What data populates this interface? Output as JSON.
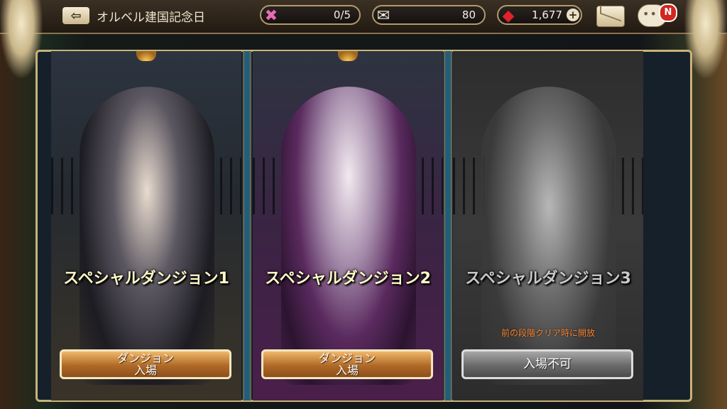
{
  "header": {
    "back_label": "オルベル建国記念日",
    "counters": [
      {
        "icon": "crossed-swords-icon",
        "value": "0/5"
      },
      {
        "icon": "ticket-icon",
        "value": "80"
      },
      {
        "icon": "red-gem-icon",
        "value": "1,677"
      }
    ],
    "notification_badge": "N"
  },
  "dungeons": [
    {
      "title": "スペシャルダンジョン1",
      "button_line1": "ダンジョン",
      "button_line2": "入場",
      "note": "",
      "locked": false
    },
    {
      "title": "スペシャルダンジョン2",
      "button_line1": "ダンジョン",
      "button_line2": "入場",
      "note": "",
      "locked": false
    },
    {
      "title": "スペシャルダンジョン3",
      "button_line1": "入場不可",
      "button_line2": "",
      "note": "前の段階クリア時に開放",
      "locked": true
    }
  ],
  "colors": {
    "accent_gold": "#c9b27a",
    "enter_button": "#b06a28",
    "locked_button": "#6a6a6a",
    "note_text": "#ff8a3a"
  }
}
